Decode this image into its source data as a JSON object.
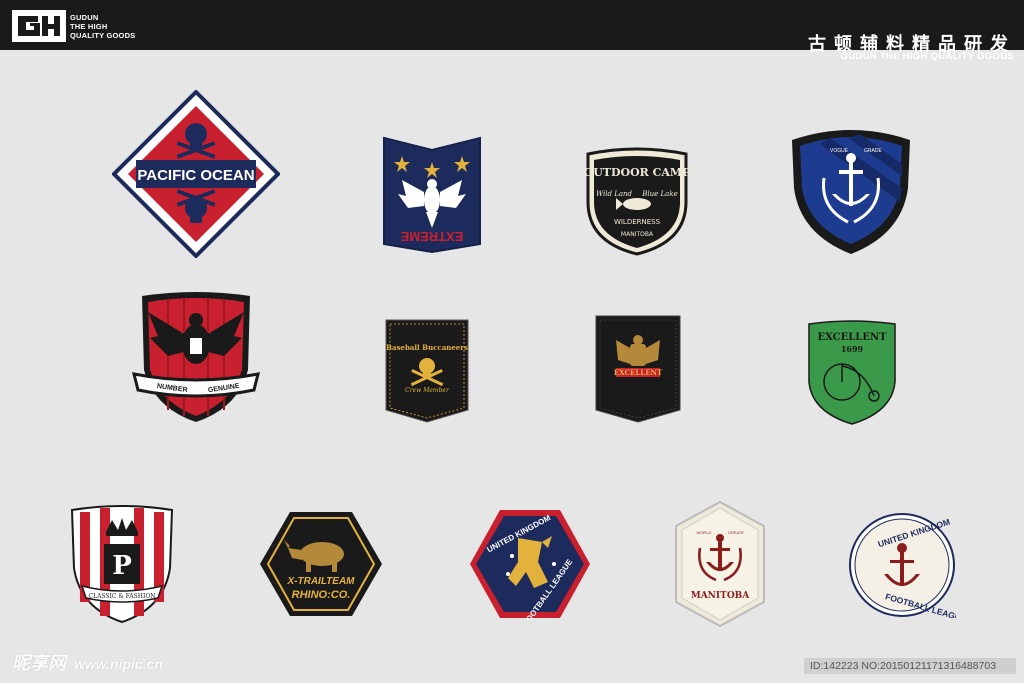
{
  "header": {
    "logo_icon": "gudun-logo",
    "logo_lines": [
      "GUDUN",
      "THE HIGH",
      "QUALITY GOODS"
    ],
    "title_cn": "古顿辅料精品研发",
    "title_en": "GUDUN THE HIGH QUALITY GOODS"
  },
  "badges": {
    "pacific": {
      "text": "PACIFIC OCEAN"
    },
    "extreme": {
      "text": "EXTREME"
    },
    "outdoor": {
      "title": "OUTDOOR CAMP",
      "left": "Wild Land",
      "right": "Blue Lake",
      "mid": "WILDERNESS",
      "bottom": "MANITOBA"
    },
    "anchor_shield": {
      "left": "VOGUE",
      "right": "GRADE"
    },
    "eagle_shield": {
      "left": "NUMBER",
      "right": "GENUINE"
    },
    "bucc": {
      "top": "Baseball Buccaneers",
      "bottom": "Crew Member"
    },
    "lion": {
      "text": "EXCELLENT"
    },
    "green": {
      "title": "EXCELLENT",
      "year": "1699"
    },
    "crown": {
      "letter": "P",
      "text": "CLASSIC & FASHION"
    },
    "rhino": {
      "line1": "X-TRAILTEAM",
      "line2": "RHINO:CO."
    },
    "uk_navy": {
      "top": "UNITED KINGDOM",
      "bottom": "FOOTBALL LEAGUE"
    },
    "manitoba": {
      "left": "WORLD",
      "right": "CREATE",
      "text": "MANITOBA"
    },
    "uk_circle": {
      "top": "UNITED KINGDOM",
      "bottom": "FOOTBALL LEAGUE"
    }
  },
  "footer": {
    "watermark": "昵享网",
    "url": "www.nipic.cn",
    "id": "ID:142223 NO:20150121171316488703"
  },
  "colors": {
    "navy": "#1d2a5c",
    "red": "#c8202e",
    "gold": "#e3b23c",
    "green": "#3b9a4a",
    "cream": "#efe9d8"
  }
}
